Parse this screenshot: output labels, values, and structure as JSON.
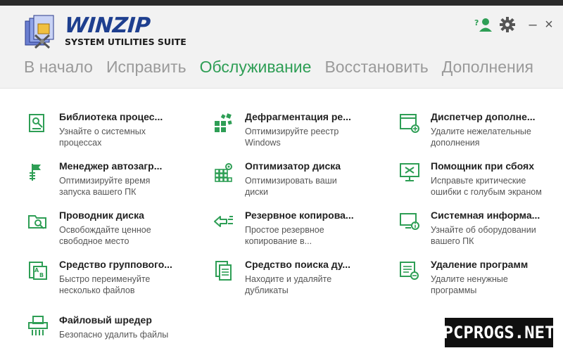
{
  "app": {
    "brand_name": "WINZIP",
    "brand_subtitle": "SYSTEM UTILITIES SUITE",
    "accent_color": "#2e9e55",
    "brand_color": "#1e3f8f"
  },
  "window_controls": {
    "help_icon": "help-user-icon",
    "settings_icon": "gear-icon",
    "minimize": "–",
    "close": "×"
  },
  "nav": {
    "tabs": [
      {
        "label": "В начало",
        "active": false
      },
      {
        "label": "Исправить",
        "active": false
      },
      {
        "label": "Обслуживание",
        "active": true
      },
      {
        "label": "Восстановить",
        "active": false
      },
      {
        "label": "Дополнения",
        "active": false
      }
    ]
  },
  "tools": {
    "col1": [
      {
        "title": "Библиотека процес...",
        "desc": "Узнайте о системных процессах",
        "icon": "process-library-icon"
      },
      {
        "title": "Менеджер автозагр...",
        "desc": "Оптимизируйте время запуска вашего ПК",
        "icon": "startup-manager-icon"
      },
      {
        "title": "Проводник диска",
        "desc": "Освобождайте ценное свободное место",
        "icon": "disk-explorer-icon"
      },
      {
        "title": "Средство группового...",
        "desc": "Быстро переименуйте несколько файлов",
        "icon": "batch-rename-icon"
      },
      {
        "title": "Файловый шредер",
        "desc": "Безопасно удалить файлы",
        "icon": "file-shredder-icon"
      }
    ],
    "col2": [
      {
        "title": "Дефрагментация ре...",
        "desc": "Оптимизируйте реестр Windows",
        "icon": "registry-defrag-icon"
      },
      {
        "title": "Оптимизатор диска",
        "desc": "Оптимизировать ваши диски",
        "icon": "disk-optimizer-icon"
      },
      {
        "title": "Резервное копирова...",
        "desc": "Простое резервное копирование в...",
        "icon": "backup-icon"
      },
      {
        "title": "Средство поиска ду...",
        "desc": "Находите и удаляйте дубликаты",
        "icon": "duplicate-finder-icon"
      }
    ],
    "col3": [
      {
        "title": "Диспетчер дополне...",
        "desc": "Удалите нежелательные дополнения",
        "icon": "addon-manager-icon"
      },
      {
        "title": "Помощник при сбоях",
        "desc": "Исправьте критические ошибки с голубым экраном",
        "icon": "crash-helper-icon"
      },
      {
        "title": "Системная информа...",
        "desc": "Узнайте об оборудовании вашего ПК",
        "icon": "system-info-icon"
      },
      {
        "title": "Удаление программ",
        "desc": "Удалите ненужные программы",
        "icon": "uninstaller-icon"
      }
    ]
  },
  "watermark": "PCPROGS.NET"
}
